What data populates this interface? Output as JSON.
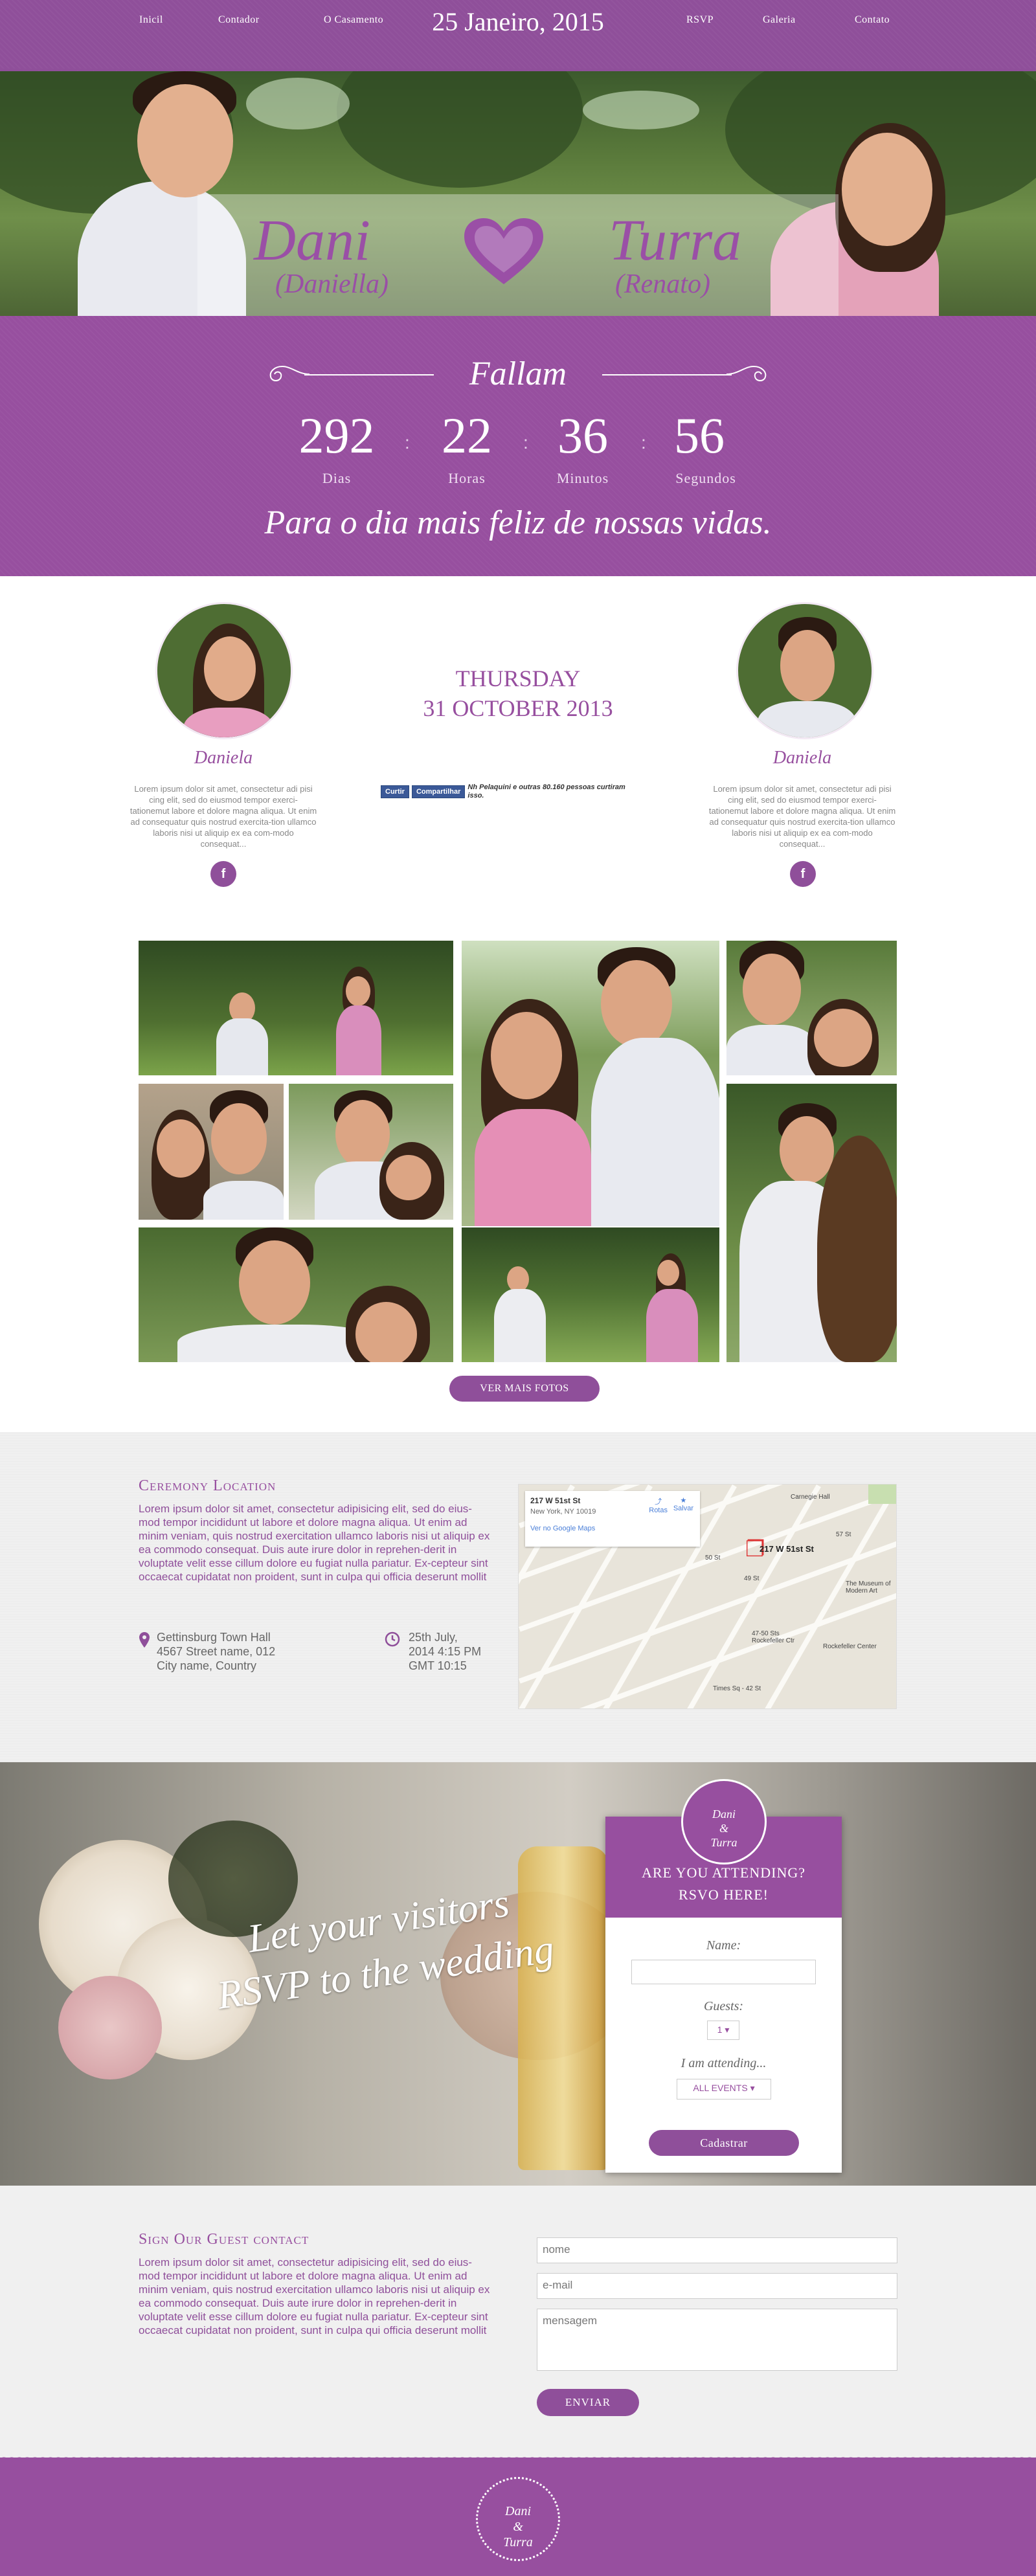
{
  "nav": {
    "left": [
      "Inicil",
      "Contador",
      "O Casamento"
    ],
    "date": "25 Janeiro, 2015",
    "right": [
      "RSVP",
      "Galeria",
      "Contato"
    ]
  },
  "hero": {
    "left_name": "Dani",
    "left_sub": "(Daniella)",
    "right_name": "Turra",
    "right_sub": "(Renato)"
  },
  "countdown": {
    "heading": "Fallam",
    "days": "292",
    "days_label": "Dias",
    "hours": "22",
    "hours_label": "Horas",
    "minutes": "36",
    "minutes_label": "Minutos",
    "seconds": "56",
    "seconds_label": "Segundos",
    "sep": ":",
    "tagline": "Para o dia mais feliz de nossas vidas."
  },
  "couple": {
    "left_name": "Daniela",
    "left_bio": "Lorem ipsum dolor sit amet, consectetur adi pisi cing elit, sed do eiusmod tempor exerci-tationemut labore et dolore magna aliqua. Ut enim ad consequatur quis nostrud exercita-tion ullamco laboris nisi ut aliquip ex ea com-modo consequat...",
    "right_name": "Daniela",
    "right_bio": "Lorem ipsum dolor sit amet, consectetur adi pisi cing elit, sed do eiusmod tempor exerci-tationemut labore et dolore magna aliqua. Ut enim ad consequatur quis nostrud exercita-tion ullamco laboris nisi ut aliquip ex ea com-modo consequat...",
    "fb_icon": "f",
    "day_line1": "THURSDAY",
    "day_line2": "31 OCTOBER 2013",
    "fb_share_btn1": "Curtir",
    "fb_share_btn2": "Compartilhar",
    "fb_share_text": "Nh Pelaquini e outras 80.160 pessoas curtiram isso."
  },
  "gallery": {
    "more_button": "VER MAIS FOTOS"
  },
  "ceremony": {
    "title": "Ceremony Location",
    "text": "Lorem ipsum dolor sit amet, consectetur adipisicing elit, sed do eius-mod tempor incididunt ut labore et dolore magna aliqua. Ut enim ad minim veniam, quis nostrud exercitation ullamco laboris nisi ut aliquip ex ea commodo consequat. Duis aute irure dolor in reprehen-derit in voluptate velit esse cillum dolore eu fugiat nulla pariatur. Ex-cepteur sint occaecat cupidatat non proident, sunt in culpa qui officia deserunt mollit",
    "address1": "Gettinsburg Town Hall",
    "address2": "4567 Street name, 012",
    "address3": "City name, Country",
    "time1": "25th July,",
    "time2": "2014 4:15 PM",
    "time3": "GMT 10:15",
    "map": {
      "title": "217 W 51st St",
      "sub": "New York, NY 10019",
      "link": "Ver no Google Maps",
      "directions": "Rotas",
      "save": "Salvar",
      "pin_label": "217 W 51st St",
      "labels": [
        "Carnegie Hall",
        "The Museum of Modern Art",
        "Rockefeller Center",
        "Times Sq - 42 St",
        "47-50 Sts Rockefeller Ctr",
        "57 St",
        "50 St",
        "49 St"
      ]
    }
  },
  "rsvp": {
    "headline_line1": "Let your visitors",
    "headline_line2": "RSVP to the wedding",
    "badge_line1": "Dani",
    "badge_line2": "&",
    "badge_line3": "Turra",
    "title_line1": "ARE YOU ATTENDING?",
    "title_line2": "RSVO HERE!",
    "name_label": "Name:",
    "guests_label": "Guests:",
    "guests_value": "1",
    "attending_label": "I am attending...",
    "attending_value": "ALL EVENTS",
    "submit": "Cadastrar"
  },
  "guest": {
    "title": "Sign Our Guest contact",
    "text": "Lorem ipsum dolor sit amet, consectetur adipisicing elit, sed do eius-mod tempor incididunt ut labore et dolore magna aliqua. Ut enim ad minim veniam, quis nostrud exercitation ullamco laboris nisi ut aliquip ex ea commodo consequat. Duis aute irure dolor in reprehen-derit in voluptate velit esse cillum dolore eu fugiat nulla pariatur. Ex-cepteur sint occaecat cupidatat non proident, sunt in culpa qui officia deserunt mollit",
    "name_placeholder": "nome",
    "email_placeholder": "e-mail",
    "message_placeholder": "mensagem",
    "send": "ENVIAR"
  },
  "footer": {
    "badge_line1": "Dani",
    "badge_line2": "&",
    "badge_line3": "Turra"
  },
  "colors": {
    "brand": "#974f9f"
  },
  "icons": [
    "heart-icon",
    "flourish-left-icon",
    "flourish-right-icon",
    "facebook-icon",
    "map-pin-icon",
    "clock-icon"
  ]
}
